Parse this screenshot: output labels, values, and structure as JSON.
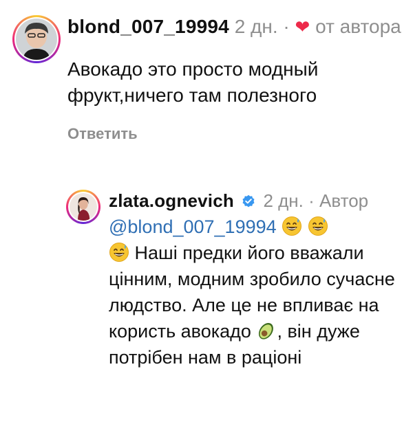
{
  "comments": [
    {
      "username": "blond_007_19994",
      "time": "2 дн.",
      "separator": "·",
      "liked_by_author": "от автора",
      "text": "Авокадо это просто модный фрукт,ничего там полезного",
      "reply_label": "Ответить",
      "avatar_icon": "user-avatar-photo"
    },
    {
      "username": "zlata.ognevich",
      "verified_icon": "verified-badge-icon",
      "time": "2 дн.",
      "separator": "·",
      "author_label": "Автор",
      "mention": "@blond_007_19994",
      "text_after_emoji": "Наші предки його вважали цінним, модним зробило сучасне людство. Але це не впливає на користь авокадо",
      "text_end": ", він дуже потрібен нам в раціоні",
      "emoji_icons": [
        "sweat-smile-emoji",
        "avocado-emoji"
      ],
      "avatar_icon": "author-avatar-photo"
    }
  ],
  "colors": {
    "mention": "#2f6fb4",
    "meta": "#8e8e8e",
    "heart": "#ed2a4a",
    "verified": "#3897f0"
  }
}
